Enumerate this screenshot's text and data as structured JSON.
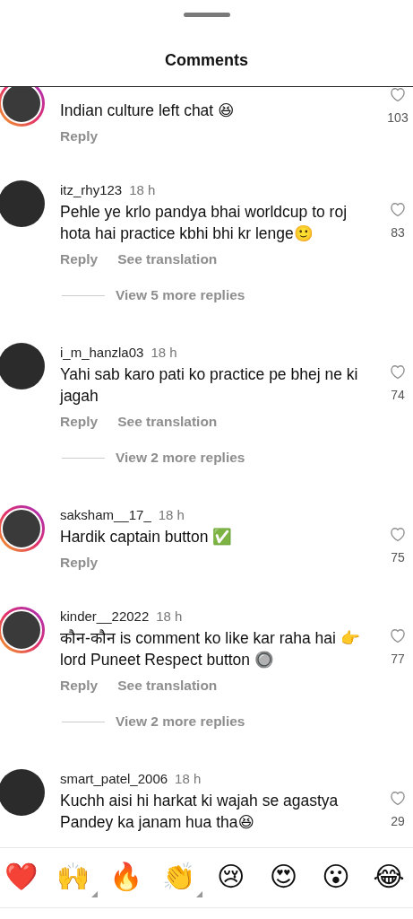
{
  "title": "Comments",
  "comments": [
    {
      "text": "Indian culture left chat 😆",
      "story_ring": true,
      "likes": "103",
      "actions": [
        "Reply"
      ]
    },
    {
      "username": "itz_rhy123",
      "time": "18 h",
      "text": "Pehle ye krlo pandya bhai  worldcup to roj hota hai practice kbhi bhi kr lenge🙂",
      "story_ring": false,
      "likes": "83",
      "actions": [
        "Reply",
        "See translation"
      ],
      "more_replies": "View 5 more replies"
    },
    {
      "username": "i_m_hanzla03",
      "time": "18 h",
      "text": "Yahi sab karo pati ko practice pe bhej ne ki jagah",
      "story_ring": false,
      "likes": "74",
      "actions": [
        "Reply",
        "See translation"
      ],
      "more_replies": "View 2 more replies"
    },
    {
      "username": "saksham__17_",
      "time": "18 h",
      "text": "Hardik captain button ✅",
      "story_ring": true,
      "likes": "75",
      "actions": [
        "Reply"
      ]
    },
    {
      "username": "kinder__22022",
      "time": "18 h",
      "text": "कौन-कौन is comment ko like kar raha hai 👉 lord Puneet Respect button 🔘",
      "story_ring": true,
      "likes": "77",
      "actions": [
        "Reply",
        "See translation"
      ],
      "more_replies": "View 2 more replies"
    },
    {
      "username": "smart_patel_2006",
      "time": "18 h",
      "text": "Kuchh aisi hi harkat ki wajah se agastya Pandey ka janam hua tha😆",
      "story_ring": false,
      "likes": "29"
    }
  ],
  "reactions": [
    {
      "emoji": "❤️",
      "variants": false
    },
    {
      "emoji": "🙌",
      "variants": true
    },
    {
      "emoji": "🔥",
      "variants": false
    },
    {
      "emoji": "👏",
      "variants": true
    },
    {
      "emoji": "😢",
      "variants": false
    },
    {
      "emoji": "😍",
      "variants": false
    },
    {
      "emoji": "😮",
      "variants": false
    },
    {
      "emoji": "😂",
      "variants": false
    }
  ]
}
